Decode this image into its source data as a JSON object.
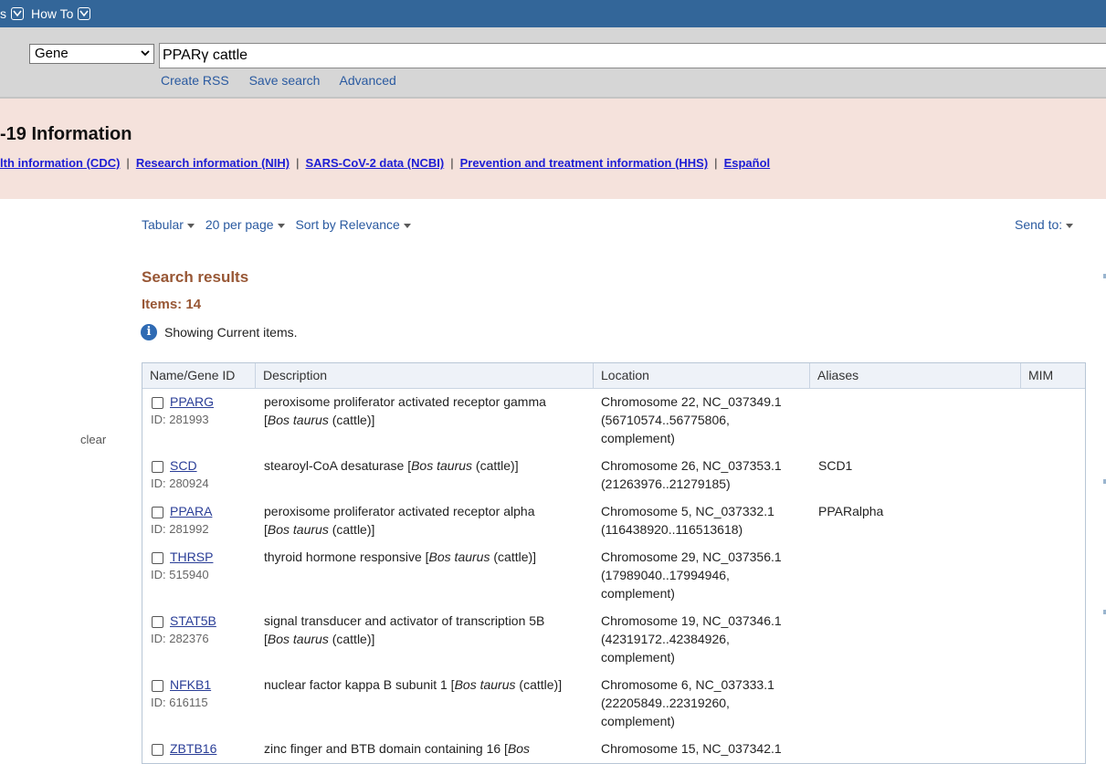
{
  "topbar": {
    "item1": "s",
    "item2": "How To"
  },
  "search": {
    "db": "Gene",
    "term": "PPARγ cattle",
    "links": [
      "Create RSS",
      "Save search",
      "Advanced"
    ]
  },
  "covid": {
    "title": "-19 Information",
    "links": [
      "lth information (CDC)",
      "Research information (NIH)",
      "SARS-CoV-2 data (NCBI)",
      "Prevention and treatment information (HHS)",
      "Español"
    ],
    "separator": "|"
  },
  "toolbar": {
    "format": "Tabular",
    "per_page": "20 per page",
    "sort": "Sort by Relevance",
    "send_to": "Send to:"
  },
  "clear_label": "clear",
  "results": {
    "title": "Search results",
    "items_label": "Items: 14",
    "notice": "Showing Current items."
  },
  "table": {
    "headers": [
      "Name/Gene ID",
      "Description",
      "Location",
      "Aliases",
      "MIM"
    ],
    "rows": [
      {
        "symbol": "PPARG",
        "id": "ID: 281993",
        "desc1": "peroxisome proliferator activated receptor gamma",
        "desc_pre": "",
        "species": "Bos taurus",
        "desc_post": " (cattle)]",
        "loc": [
          "Chromosome 22, NC_037349.1",
          "(56710574..56775806,",
          "complement)"
        ],
        "alias": ""
      },
      {
        "symbol": "SCD",
        "id": "ID: 280924",
        "desc1": "",
        "desc_pre": "stearoyl-CoA desaturase [",
        "species": "Bos taurus",
        "desc_post": " (cattle)]",
        "loc": [
          "Chromosome 26, NC_037353.1",
          "(21263976..21279185)"
        ],
        "alias": "SCD1"
      },
      {
        "symbol": "PPARA",
        "id": "ID: 281992",
        "desc1": "peroxisome proliferator activated receptor alpha",
        "desc_pre": "",
        "species": "Bos taurus",
        "desc_post": " (cattle)]",
        "loc": [
          "Chromosome 5, NC_037332.1",
          "(116438920..116513618)"
        ],
        "alias": "PPARalpha"
      },
      {
        "symbol": "THRSP",
        "id": "ID: 515940",
        "desc1": "",
        "desc_pre": "thyroid hormone responsive [",
        "species": "Bos taurus",
        "desc_post": " (cattle)]",
        "loc": [
          "Chromosome 29, NC_037356.1",
          "(17989040..17994946,",
          "complement)"
        ],
        "alias": ""
      },
      {
        "symbol": "STAT5B",
        "id": "ID: 282376",
        "desc1": "signal transducer and activator of transcription 5B",
        "desc_pre": "",
        "species": "Bos taurus",
        "desc_post": " (cattle)]",
        "loc": [
          "Chromosome 19, NC_037346.1",
          "(42319172..42384926,",
          "complement)"
        ],
        "alias": ""
      },
      {
        "symbol": "NFKB1",
        "id": "ID: 616115",
        "desc1": "",
        "desc_pre": "nuclear factor kappa B subunit 1 [",
        "species": "Bos taurus",
        "desc_post": " (cattle)]",
        "loc": [
          "Chromosome 6, NC_037333.1",
          "(22205849..22319260,",
          "complement)"
        ],
        "alias": ""
      },
      {
        "symbol": "ZBTB16",
        "id": "",
        "desc1": "",
        "desc_pre": "zinc finger and BTB domain containing 16 [",
        "species": "Bos",
        "desc_post": "",
        "loc": [
          "Chromosome 15, NC_037342.1"
        ],
        "alias": ""
      }
    ]
  },
  "colors": {
    "topbar": "#336699",
    "banner": "#f5e2dc",
    "heading": "#985735",
    "link": "#2a3e97"
  }
}
